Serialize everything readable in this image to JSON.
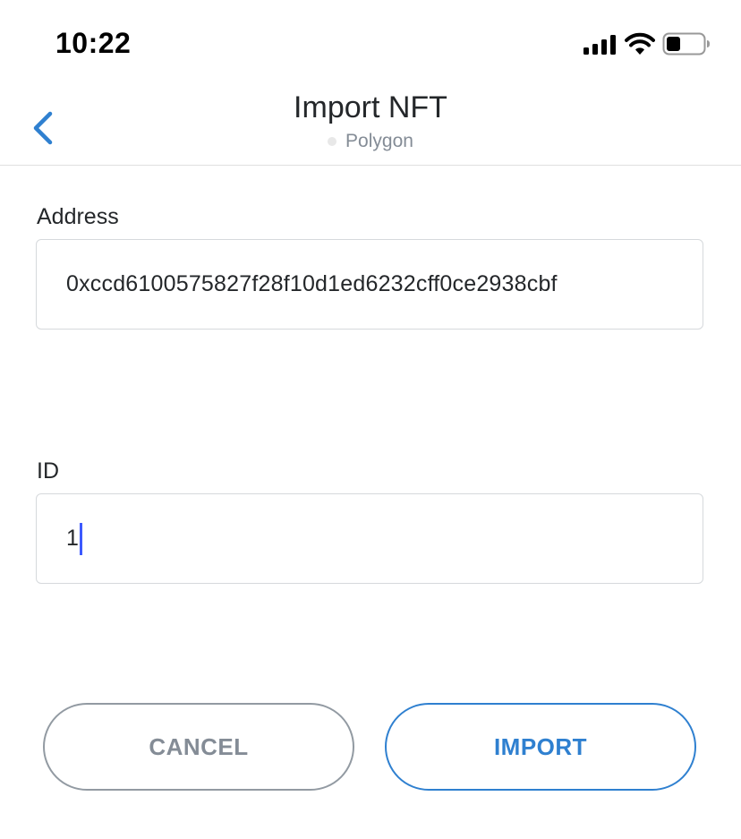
{
  "status_bar": {
    "time": "10:22"
  },
  "header": {
    "title": "Import NFT",
    "network": "Polygon",
    "back_icon": "chevron-left-icon"
  },
  "form": {
    "address_label": "Address",
    "address_value": "0xccd6100575827f28f10d1ed6232cff0ce2938cbf",
    "id_label": "ID",
    "id_value": "1"
  },
  "actions": {
    "cancel_label": "CANCEL",
    "import_label": "IMPORT"
  },
  "colors": {
    "accent": "#2f80d0",
    "muted_text": "#848c96",
    "cancel_border": "#929aa2",
    "field_border": "#d6d9dc",
    "caret": "#3d5afe"
  }
}
